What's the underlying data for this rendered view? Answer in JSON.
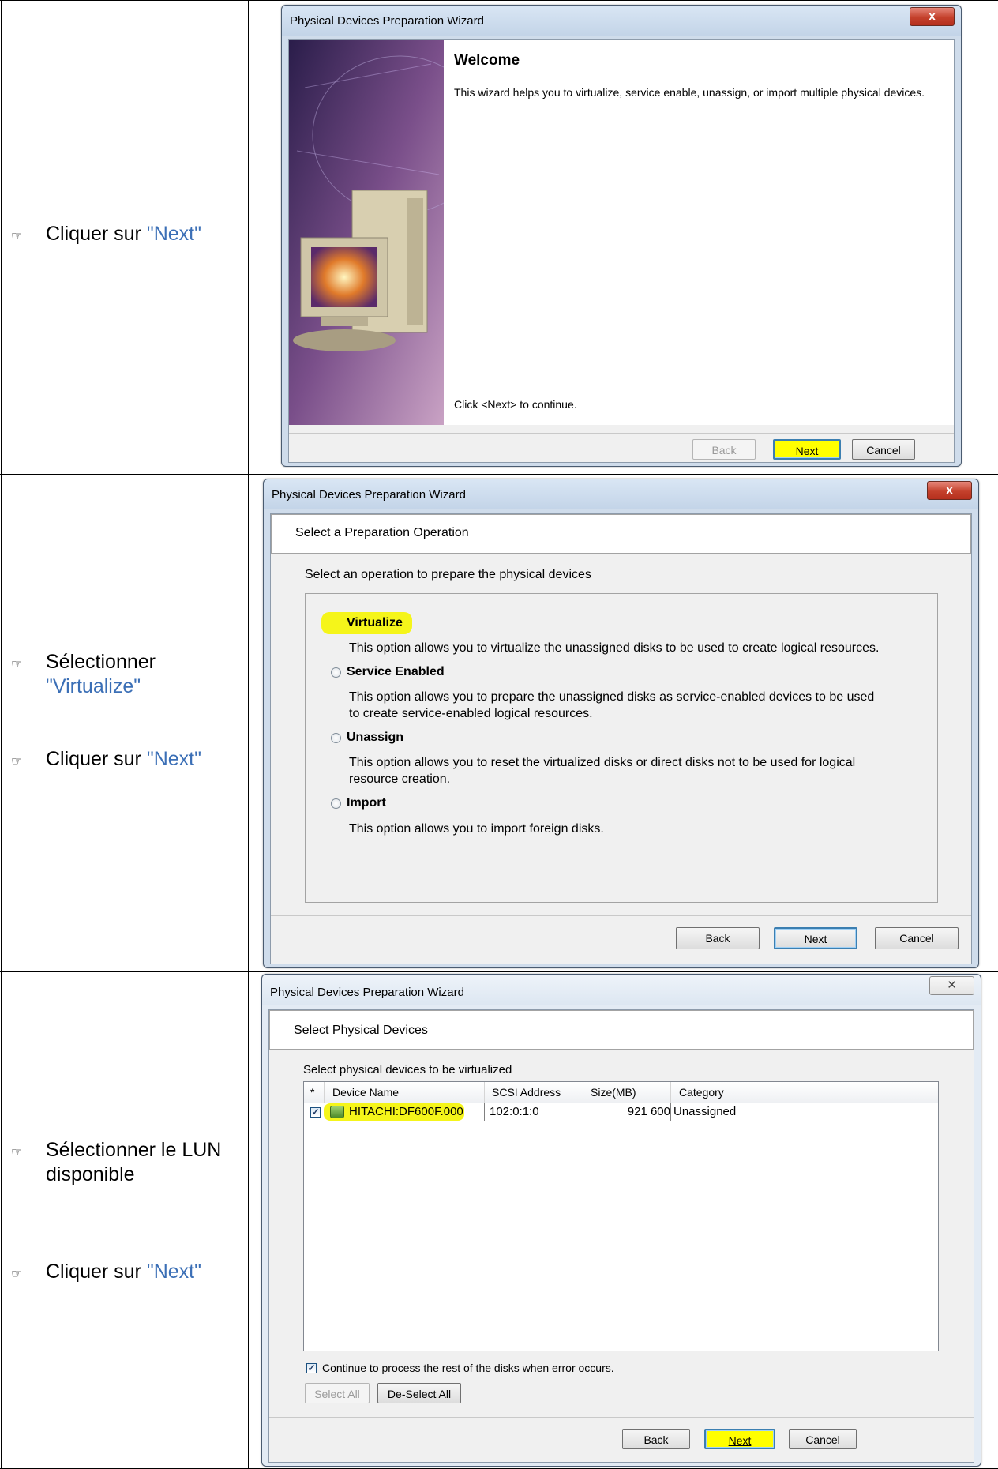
{
  "steps": [
    {
      "instructions": [
        {
          "prefix": "Cliquer sur ",
          "keyword": "\"Next\""
        }
      ],
      "wizard": {
        "title": "Physical Devices Preparation Wizard",
        "close_glyph": "x",
        "heading": "Welcome",
        "description": "This wizard helps you to virtualize, service enable, unassign, or import multiple physical devices.",
        "footer_text": "Click <Next> to continue.",
        "buttons": {
          "back": "Back",
          "next": "Next",
          "cancel": "Cancel"
        }
      }
    },
    {
      "instructions": [
        {
          "prefix": "Sélectionner ",
          "keyword": "\"Virtualize\""
        },
        {
          "prefix": "Cliquer sur ",
          "keyword": "\"Next\""
        }
      ],
      "wizard": {
        "title": "Physical Devices Preparation Wizard",
        "close_glyph": "x",
        "header": "Select a Preparation Operation",
        "prompt": "Select an operation to prepare the physical devices",
        "options": [
          {
            "label": "Virtualize",
            "description": "This option allows you to virtualize the unassigned disks to be used to create logical resources.",
            "selected": true
          },
          {
            "label": "Service Enabled",
            "description_lines": [
              "This option allows you to prepare the unassigned disks as service-enabled devices to be used",
              "to create service-enabled logical resources."
            ],
            "selected": false
          },
          {
            "label": "Unassign",
            "description_lines": [
              "This option allows you to reset the virtualized disks or direct disks not to be used for logical",
              "resource creation."
            ],
            "selected": false
          },
          {
            "label": "Import",
            "description": "This option allows you to import foreign disks.",
            "selected": false
          }
        ],
        "buttons": {
          "back": "Back",
          "next": "Next",
          "cancel": "Cancel"
        }
      }
    },
    {
      "instructions": [
        {
          "text": "Sélectionner le LUN disponible"
        },
        {
          "prefix": "Cliquer sur ",
          "keyword": "\"Next\""
        }
      ],
      "wizard": {
        "title": "Physical Devices Preparation Wizard",
        "close_glyph": "✕",
        "header": "Select Physical Devices",
        "prompt": "Select physical devices to be virtualized",
        "columns": [
          "*",
          "Device Name",
          "SCSI Address",
          "Size(MB)",
          "Category"
        ],
        "rows": [
          {
            "checked": true,
            "device_name": "HITACHI:DF600F.000",
            "scsi_address": "102:0:1:0",
            "size_mb": "921 600",
            "category": "Unassigned"
          }
        ],
        "continue_checkbox_label": "Continue to process the rest of the disks when error occurs.",
        "continue_checked": true,
        "select_all": "Select All",
        "deselect_all": "De-Select All",
        "buttons": {
          "back": "Back",
          "next": "Next",
          "cancel": "Cancel"
        }
      }
    }
  ],
  "colors": {
    "keyword": "#3b6fb6",
    "highlight": "#ffff00",
    "close_red": "#c4412c"
  }
}
